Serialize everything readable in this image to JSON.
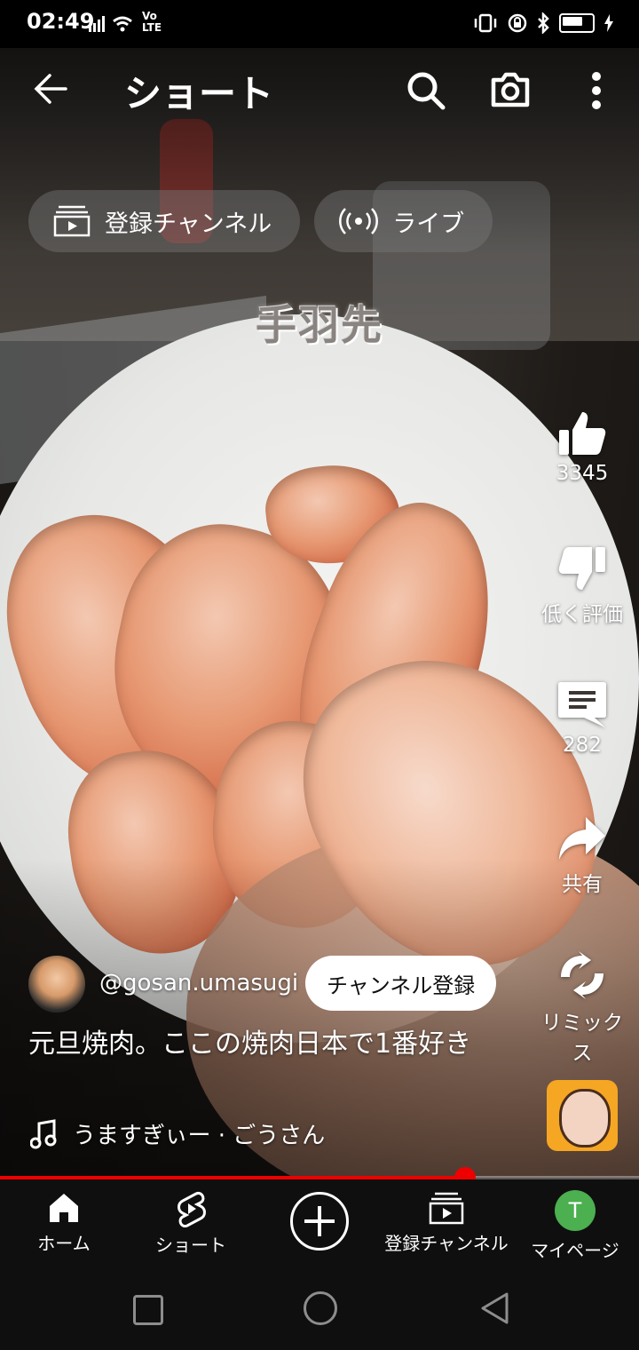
{
  "status_bar": {
    "time": "02:49",
    "network": "Vo LTE"
  },
  "header": {
    "title": "ショート"
  },
  "chips": [
    {
      "label": "登録チャンネル",
      "icon": "subscriptions-icon"
    },
    {
      "label": "ライブ",
      "icon": "live-icon"
    }
  ],
  "video": {
    "overlay_caption": "手羽先"
  },
  "actions": {
    "like_count": "3345",
    "dislike_label": "低く評価",
    "comment_count": "282",
    "share_label": "共有",
    "remix_label": "リミックス"
  },
  "channel": {
    "handle": "@gosan.umasugi",
    "subscribe_label": "チャンネル登録"
  },
  "description": "元旦焼肉。ここの焼肉日本で1番好き",
  "music": {
    "title": "うますぎぃー · ごうさん"
  },
  "progress": {
    "fraction": 0.728
  },
  "bottom_nav": {
    "home": "ホーム",
    "shorts": "ショート",
    "subscriptions": "登録チャンネル",
    "me": "マイページ",
    "me_initial": "T"
  },
  "colors": {
    "accent": "#ff0000",
    "nav_bg": "#0f0f0f",
    "avatar_green": "#4caf50"
  }
}
